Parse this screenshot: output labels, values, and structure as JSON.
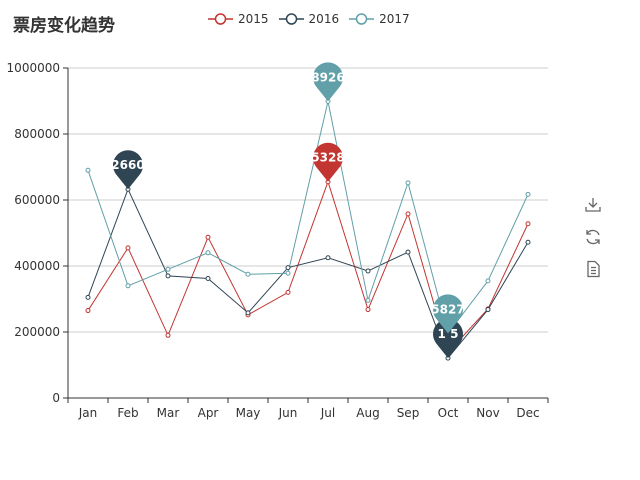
{
  "chart_data": {
    "type": "line",
    "title": "票房变化趋势",
    "categories": [
      "Jan",
      "Feb",
      "Mar",
      "Apr",
      "May",
      "Jun",
      "Jul",
      "Aug",
      "Sep",
      "Oct",
      "Nov",
      "Dec"
    ],
    "ylim": [
      0,
      1000000
    ],
    "yticks": [
      0,
      200000,
      400000,
      600000,
      800000,
      1000000
    ],
    "grid": "horizontal",
    "legend_position": "top-center",
    "series": [
      {
        "name": "2015",
        "color": "#c23531",
        "values": [
          265000,
          455000,
          190000,
          487000,
          252000,
          320000,
          655328,
          268000,
          558000,
          138000,
          270000,
          528000
        ]
      },
      {
        "name": "2016",
        "color": "#2f4554",
        "values": [
          305000,
          632660,
          370000,
          362000,
          258000,
          395000,
          425000,
          385000,
          442000,
          121000,
          268000,
          472000
        ]
      },
      {
        "name": "2017",
        "color": "#61a0a8",
        "values": [
          690000,
          340000,
          390000,
          440000,
          375000,
          378000,
          898926,
          296000,
          652000,
          195827,
          355000,
          617000
        ]
      }
    ],
    "markers": [
      {
        "series": "2016",
        "category": "Feb",
        "label": "2660"
      },
      {
        "series": "2015",
        "category": "Jul",
        "label": "5328"
      },
      {
        "series": "2017",
        "category": "Jul",
        "label": "8926"
      },
      {
        "series": "2016",
        "category": "Oct",
        "label": "1 5"
      },
      {
        "series": "2017",
        "category": "Oct",
        "label": "5827"
      }
    ]
  },
  "toolbox": {
    "items": [
      {
        "name": "save-as-image",
        "icon": "download-icon"
      },
      {
        "name": "restore",
        "icon": "refresh-icon"
      },
      {
        "name": "data-view",
        "icon": "document-icon"
      }
    ]
  }
}
